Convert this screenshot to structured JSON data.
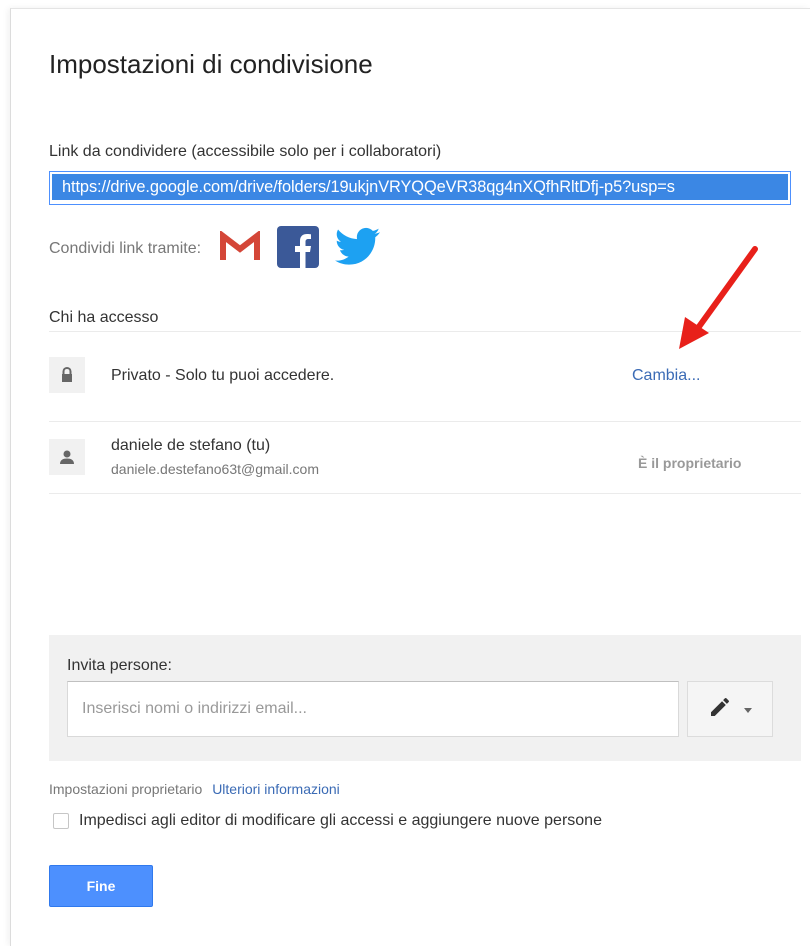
{
  "dialog": {
    "title": "Impostazioni di condivisione"
  },
  "link": {
    "label": "Link da condividere (accessibile solo per i collaboratori)",
    "value": "https://drive.google.com/drive/folders/19ukjnVRYQQeVR38qg4nXQfhRltDfj-p5?usp=s"
  },
  "share": {
    "label": "Condividi link tramite:",
    "icons": [
      "gmail-icon",
      "facebook-icon",
      "twitter-icon"
    ],
    "colors": {
      "gmail": "#d44638",
      "facebook": "#3b5998",
      "twitter": "#1da1f2"
    }
  },
  "access": {
    "section_label": "Chi ha accesso",
    "rows": [
      {
        "icon": "lock-icon",
        "text": "Privato - Solo tu puoi accedere.",
        "action": "Cambia..."
      },
      {
        "icon": "person-icon",
        "name": "daniele de stefano (tu)",
        "email": "daniele.destefano63t@gmail.com",
        "role": "È il proprietario"
      }
    ]
  },
  "invite": {
    "label": "Invita persone:",
    "placeholder": "Inserisci nomi o indirizzi email...",
    "permission_icon": "pencil-icon"
  },
  "owner_settings": {
    "label": "Impostazioni proprietario",
    "link": "Ulteriori informazioni",
    "checkbox_label": "Impedisci agli editor di modificare gli accessi e aggiungere nuove persone",
    "checked": false
  },
  "footer": {
    "done_label": "Fine"
  },
  "colors": {
    "accent": "#4d90fe",
    "link": "#3b6bb5",
    "annotation_arrow": "#e8201a"
  }
}
